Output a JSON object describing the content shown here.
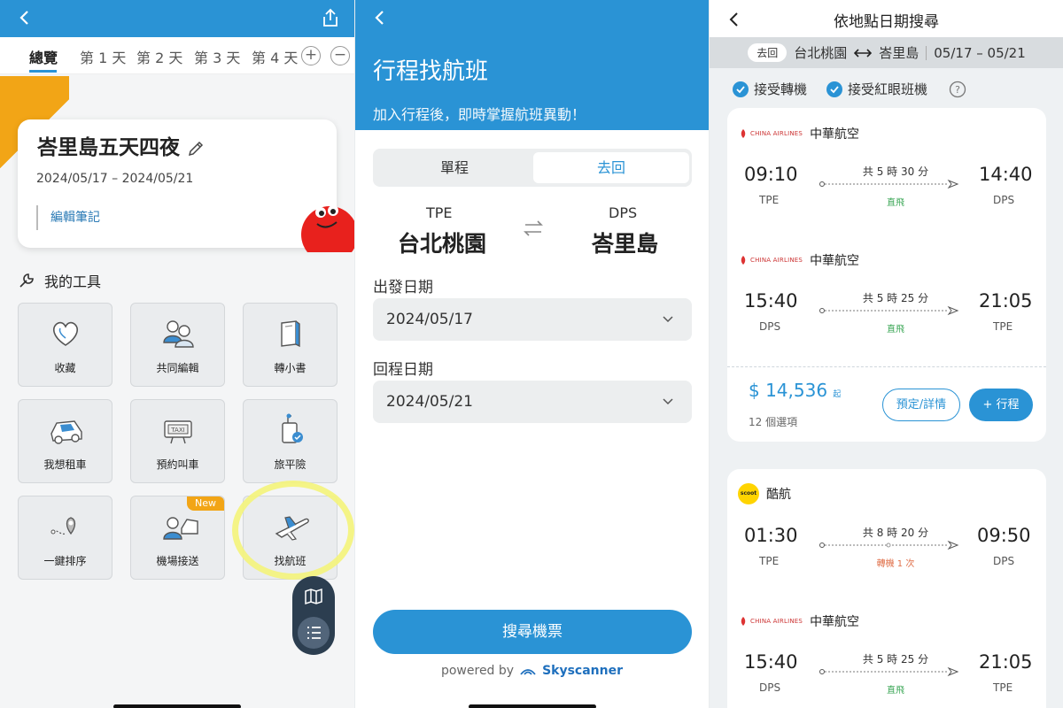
{
  "panel1": {
    "tabs": [
      "總覽",
      "第 1 天",
      "第 2 天",
      "第 3 天",
      "第 4 天"
    ],
    "tab_add": "+",
    "tab_remove": "−",
    "trip": {
      "title": "峇里島五天四夜",
      "dates": "2024/05/17 – 2024/05/21",
      "note_link": "編輯筆記"
    },
    "tools_title": "我的工具",
    "tools": [
      {
        "label": "收藏",
        "icon": "heart-icon"
      },
      {
        "label": "共同編輯",
        "icon": "people-icon"
      },
      {
        "label": "轉小書",
        "icon": "book-icon"
      },
      {
        "label": "我想租車",
        "icon": "car-icon"
      },
      {
        "label": "預約叫車",
        "icon": "taxi-icon"
      },
      {
        "label": "旅平險",
        "icon": "luggage-shield-icon"
      },
      {
        "label": "一鍵排序",
        "icon": "route-pin-icon"
      },
      {
        "label": "機場接送",
        "icon": "airport-transfer-icon",
        "badge": "New"
      },
      {
        "label": "找航班",
        "icon": "airplane-icon"
      }
    ],
    "colors": {
      "accent": "#2a93d5",
      "orange": "#f2a516",
      "highlight": "#f4f47a"
    }
  },
  "panel2": {
    "title": "行程找航班",
    "subtitle": "加入行程後，即時掌握航班異動！",
    "trip_type_options": [
      "單程",
      "去回"
    ],
    "selected_trip_type": "去回",
    "origin": {
      "code": "TPE",
      "city": "台北桃園"
    },
    "destination": {
      "code": "DPS",
      "city": "峇里島"
    },
    "depart_label": "出發日期",
    "depart_value": "2024/05/17",
    "return_label": "回程日期",
    "return_value": "2024/05/21",
    "search_button": "搜尋機票",
    "powered_by": "powered by",
    "powered_brand": "Skyscanner"
  },
  "panel3": {
    "title": "依地點日期搜尋",
    "route_pill": "去回",
    "route_from": "台北桃園",
    "route_to": "峇里島",
    "route_dates": "05/17 – 05/21",
    "filters": [
      "接受轉機",
      "接受紅眼班機"
    ],
    "card1": {
      "legs": [
        {
          "airline": "中華航空",
          "logo_text": "CHINA AIRLINES",
          "dep": "09:10",
          "dep_code": "TPE",
          "arr": "14:40",
          "arr_code": "DPS",
          "duration": "共 5 時 30 分",
          "tag": "直飛"
        },
        {
          "airline": "中華航空",
          "logo_text": "CHINA AIRLINES",
          "dep": "15:40",
          "dep_code": "DPS",
          "arr": "21:05",
          "arr_code": "TPE",
          "duration": "共 5 時 25 分",
          "tag": "直飛"
        }
      ],
      "price": "$ 14,536",
      "price_suffix": "起",
      "options": "12 個選項",
      "details_button": "預定/詳情",
      "add_button": "+ 行程"
    },
    "card2": {
      "legs": [
        {
          "airline": "酷航",
          "logo_text": "scoot",
          "dep": "01:30",
          "dep_code": "TPE",
          "arr": "09:50",
          "arr_code": "DPS",
          "duration": "共 8 時 20 分",
          "tag": "轉機 1 次"
        },
        {
          "airline": "中華航空",
          "logo_text": "CHINA AIRLINES",
          "dep": "15:40",
          "dep_code": "DPS",
          "arr": "21:05",
          "arr_code": "TPE",
          "duration": "共 5 時 25 分",
          "tag": "直飛"
        }
      ]
    },
    "colors": {
      "direct": "#3aa655",
      "transfer": "#e0704a"
    }
  }
}
